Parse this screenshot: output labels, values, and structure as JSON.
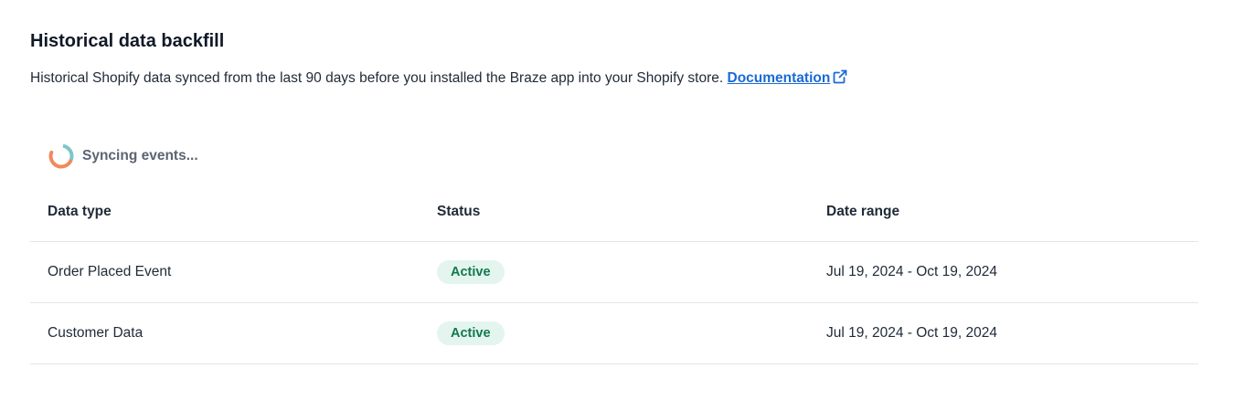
{
  "header": {
    "title": "Historical data backfill",
    "description": "Historical Shopify data synced from the last 90 days before you installed the Braze app into your Shopify store.",
    "documentation_link": "Documentation"
  },
  "sync_status": {
    "label": "Syncing events..."
  },
  "table": {
    "columns": [
      "Data type",
      "Status",
      "Date range"
    ],
    "rows": [
      {
        "data_type": "Order Placed Event",
        "status": "Active",
        "date_range": "Jul 19, 2024 - Oct 19, 2024"
      },
      {
        "data_type": "Customer Data",
        "status": "Active",
        "date_range": "Jul 19, 2024 - Oct 19, 2024"
      }
    ]
  },
  "colors": {
    "link": "#1b6ad6",
    "active_badge_bg": "#e3f5ee",
    "active_badge_text": "#12794e",
    "spinner_orange": "#f08a5d",
    "spinner_teal": "#7cc6c9"
  },
  "icons": {
    "external_link": "external-link-icon",
    "spinner": "loading-spinner-icon"
  }
}
